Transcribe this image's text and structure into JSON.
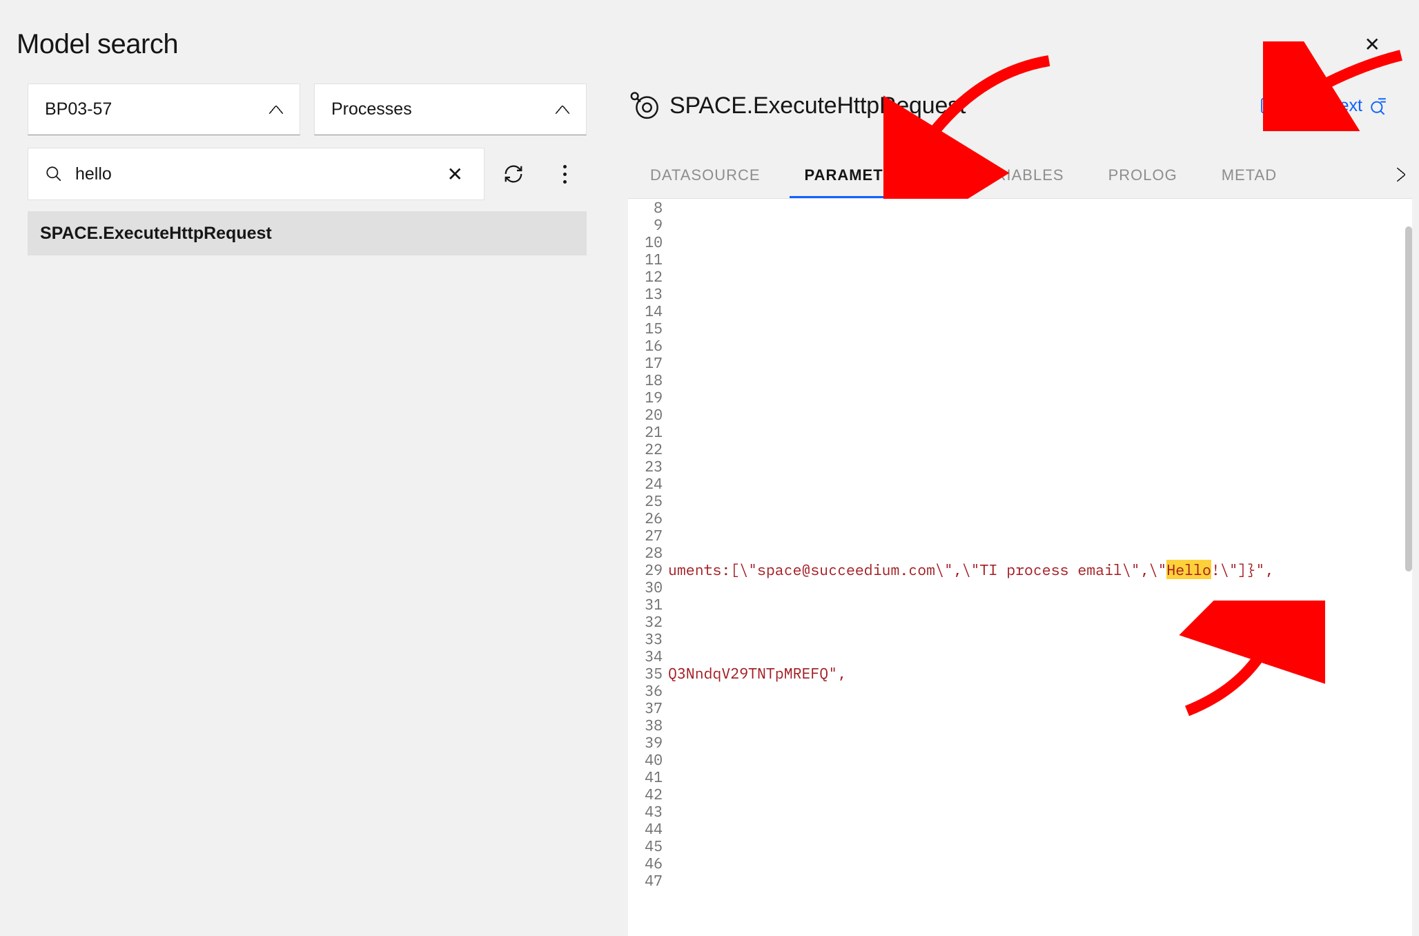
{
  "title": "Model search",
  "close_glyph": "✕",
  "selectors": {
    "database": "BP03-57",
    "object_type": "Processes"
  },
  "search": {
    "value": "hello",
    "clear_glyph": "✕"
  },
  "results": {
    "items": [
      {
        "label": "SPACE.ExecuteHttpRequest"
      }
    ]
  },
  "detail": {
    "title": "SPACE.ExecuteHttpRequest",
    "next_label": "Next",
    "tabs": [
      {
        "label": "DATASOURCE",
        "active": false,
        "dot": false
      },
      {
        "label": "PARAMETERS",
        "active": true,
        "dot": true
      },
      {
        "label": "VARIABLES",
        "active": false,
        "dot": false
      },
      {
        "label": "PROLOG",
        "active": false,
        "dot": false
      },
      {
        "label": "METAD",
        "active": false,
        "dot": false
      }
    ],
    "editor": {
      "first_line": 8,
      "last_line": 47,
      "highlight_word": "Hello",
      "line29_pre": "uments:[\\\"space@succeedium.com\\\",\\\"TI process email\\\",\\\"",
      "line29_post": "!\\\"]}\",",
      "line35": "Q3NndqV29TNTpMREFQ\","
    }
  }
}
